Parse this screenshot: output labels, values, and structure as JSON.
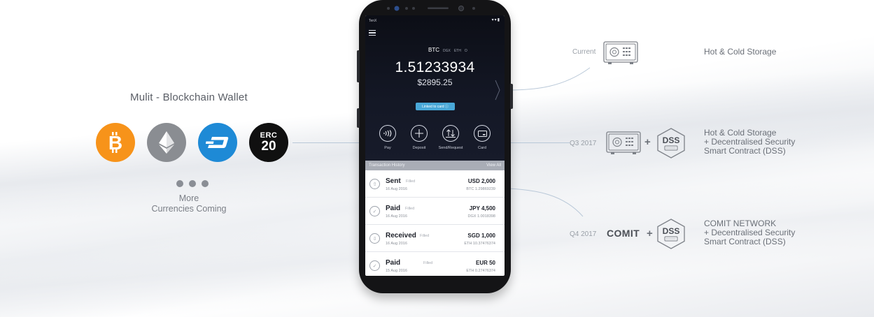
{
  "left": {
    "title": "Mulit - Blockchain Wallet",
    "coins": [
      {
        "icon": "bitcoin-icon",
        "color": "#f7931a"
      },
      {
        "icon": "ethereum-icon",
        "color": "#8a8d92"
      },
      {
        "icon": "dash-icon",
        "color": "#1e8ad6"
      },
      {
        "icon": "erc20-icon",
        "color": "#101010",
        "text_top": "ERC",
        "text_bottom": "20"
      }
    ],
    "more_line1": "More",
    "more_line2": "Currencies Coming"
  },
  "phone": {
    "status_left": "TenX",
    "status_right": "▾▾▮",
    "currency_active": "BTC",
    "currency_tabs": [
      "DGX",
      "ETH",
      "O"
    ],
    "balance": "1.51233934",
    "fiat_balance": "$2895.25",
    "linked_label": "Linked to card ⓘ",
    "actions": [
      {
        "label": "Pay",
        "icon": "contactless-pay-icon"
      },
      {
        "label": "Deposit",
        "icon": "plus-icon"
      },
      {
        "label": "Send/Request",
        "icon": "send-request-icon"
      },
      {
        "label": "Card",
        "icon": "card-icon"
      }
    ],
    "history_title": "Transaction History",
    "history_view_all": "View All",
    "transactions": [
      {
        "type": "Sent",
        "status": "Filled",
        "date": "16 Aug 2016",
        "amount": "USD 2,000",
        "crypto": "BTC 1.29869239",
        "icon": "upload-icon"
      },
      {
        "type": "Paid",
        "status": "Filled",
        "date": "16 Aug 2016",
        "amount": "JPY 4,500",
        "crypto": "DGX 1.0018398",
        "icon": "check-icon"
      },
      {
        "type": "Received",
        "status": "Filled",
        "date": "16 Aug 2016",
        "amount": "SGD 1,000",
        "crypto": "ETH 10.37476374",
        "icon": "download-icon"
      },
      {
        "type": "Paid",
        "status": "Filled",
        "date": "15 Aug 2016",
        "amount": "EUR 50",
        "crypto": "ETH 0.27476374",
        "icon": "check-icon"
      }
    ]
  },
  "roadmap": {
    "current": {
      "label": "Current",
      "desc_line1": "Hot & Cold Storage"
    },
    "q3": {
      "label": "Q3 2017",
      "dss": "DSS",
      "plus": "+",
      "desc_line1": "Hot & Cold Storage",
      "desc_line2": "+ Decentralised Security",
      "desc_line3": "Smart Contract (DSS)"
    },
    "q4": {
      "label": "Q4 2017",
      "comit": "COMIT",
      "dss": "DSS",
      "plus": "+",
      "desc_line1": "COMIT NETWORK",
      "desc_line2": "+ Decentralised Security",
      "desc_line3": "Smart Contract (DSS)"
    }
  },
  "colors": {
    "accent": "#49a8d8",
    "phone_dark": "#141826"
  }
}
